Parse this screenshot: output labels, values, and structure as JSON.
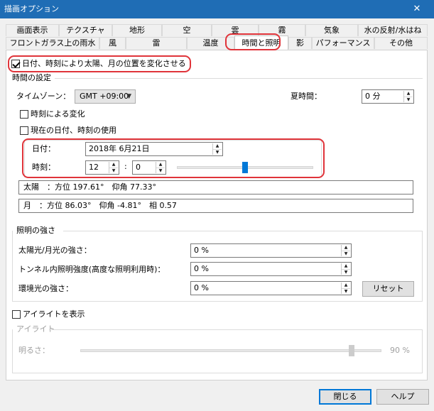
{
  "window": {
    "title": "描画オプション",
    "close_glyph": "✕"
  },
  "tabs_row1": [
    "画面表示",
    "テクスチャ",
    "地形",
    "空",
    "雲",
    "霧",
    "気象",
    "水の反射/水はね"
  ],
  "tabs_row2": [
    "フロントガラス上の雨水",
    "風",
    "雷",
    "温度",
    "時間と照明",
    "影",
    "パフォーマンス",
    "その他"
  ],
  "active_tab": "時間と照明",
  "sun_moon_toggle": {
    "label": "日付、時刻により太陽、月の位置を変化させる",
    "checked": true
  },
  "time_settings": {
    "group_label": "時間の設定",
    "timezone_label": "タイムゾーン：",
    "timezone_value": "GMT +09:00",
    "dst_label": "夏時間：",
    "dst_value": "0 分",
    "time_change_label": "時刻による変化",
    "time_change_checked": false,
    "use_current_label": "現在の日付、時刻の使用",
    "use_current_checked": false,
    "date_label": "日付：",
    "date_value": "2018年  6月21日",
    "time_label": "時刻：",
    "hour_value": "12",
    "minute_value": "0",
    "time_separator": ":",
    "time_slider_fraction": 0.5,
    "sun_info": "太陽　：方位 197.61°　仰角 77.33°",
    "moon_info": "月　：方位 86.03°　仰角 -4.81°　相 0.57"
  },
  "lighting": {
    "group_label": "照明の強さ",
    "sunlight_label": "太陽光/月光の強さ：",
    "sunlight_value": "0 %",
    "tunnel_label": "トンネル内照明強度(高度な照明利用時)：",
    "tunnel_value": "0 %",
    "ambient_label": "環境光の強さ：",
    "ambient_value": "0 %",
    "reset_label": "リセット"
  },
  "eyelight": {
    "show_label": "アイライトを表示",
    "show_checked": false,
    "group_label": "アイライト",
    "brightness_label": "明るさ：",
    "brightness_value": "90 %",
    "brightness_fraction": 0.9
  },
  "buttons": {
    "close_label": "閉じる",
    "help_label": "ヘルプ"
  }
}
